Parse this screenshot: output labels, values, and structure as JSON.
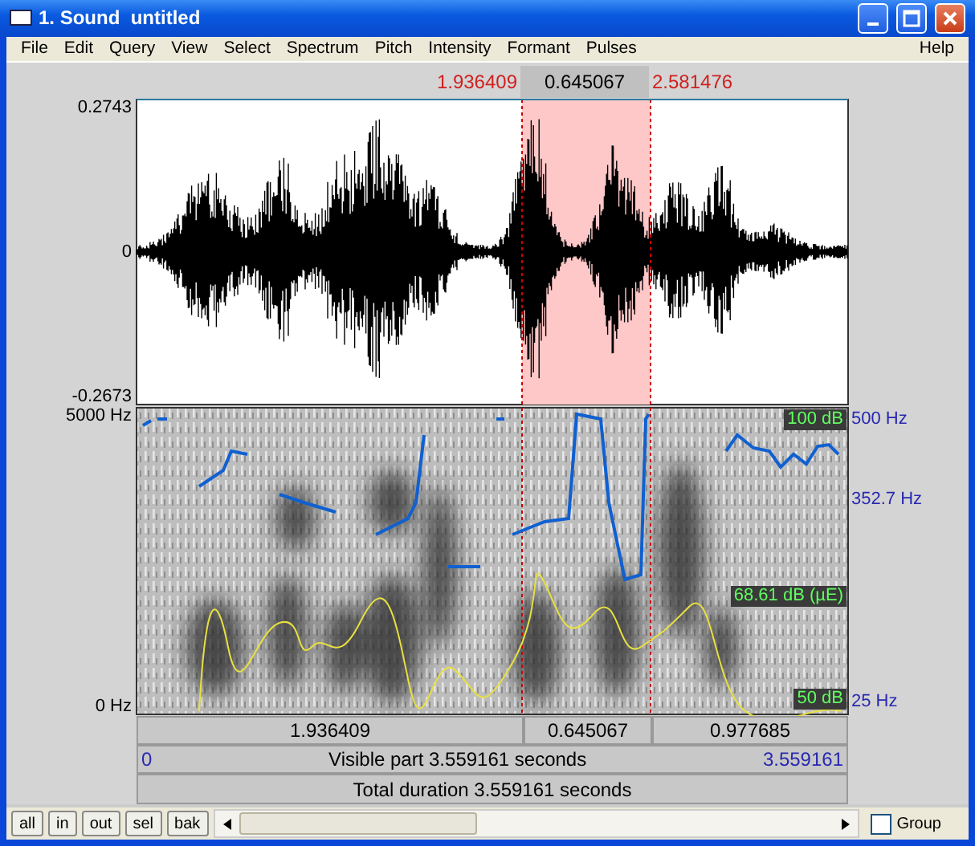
{
  "window": {
    "title": "1. Sound  untitled"
  },
  "menu": [
    "File",
    "Edit",
    "Query",
    "View",
    "Select",
    "Spectrum",
    "Pitch",
    "Intensity",
    "Formant",
    "Pulses"
  ],
  "help": "Help",
  "selection": {
    "start": "1.936409",
    "duration": "0.645067",
    "end": "2.581476"
  },
  "waveform": {
    "y_max": "0.2743",
    "y_zero": "0",
    "y_min": "-0.2673"
  },
  "spectrogram": {
    "freq_top": "5000 Hz",
    "freq_bottom": "0 Hz",
    "pitch_labels": [
      "500 Hz",
      "352.7 Hz",
      "25 Hz"
    ],
    "intensity_labels": [
      "100 dB",
      "68.61 dB (µE)",
      "50 dB"
    ]
  },
  "segments": [
    "1.936409",
    "0.645067",
    "0.977685"
  ],
  "visible": {
    "start": "0",
    "label": "Visible part 3.559161 seconds",
    "end": "3.559161"
  },
  "total": "Total duration 3.559161 seconds",
  "buttons": [
    "all",
    "in",
    "out",
    "sel",
    "bak"
  ],
  "scrollbar": {
    "level": 0.4
  },
  "group": {
    "label": "Group",
    "checked": false
  }
}
